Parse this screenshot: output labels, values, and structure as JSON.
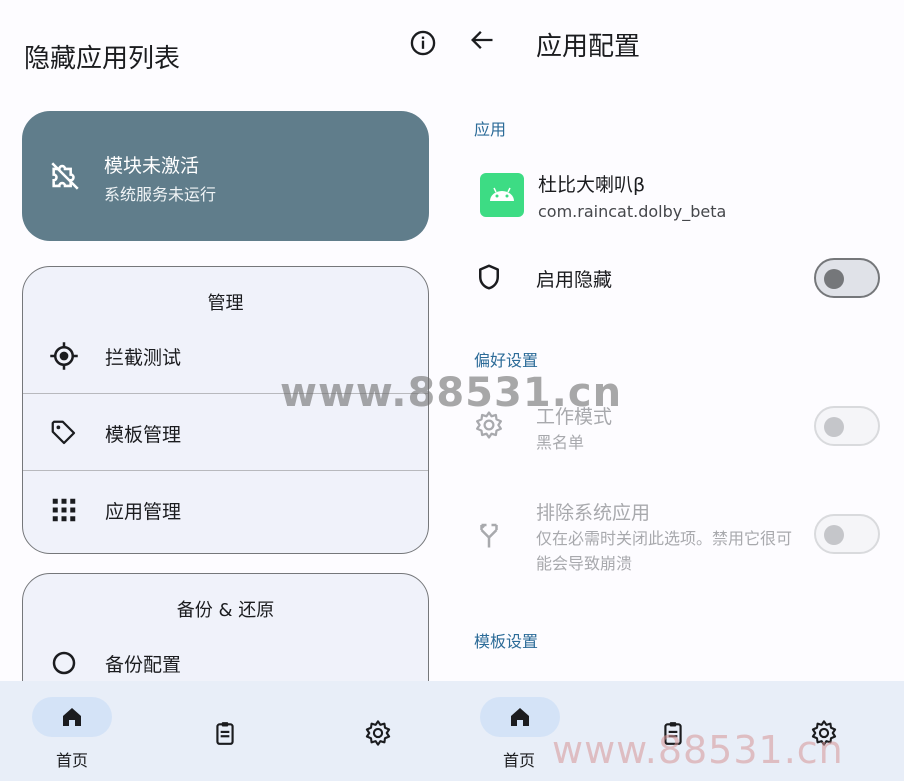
{
  "left": {
    "title": "隐藏应用列表",
    "info_icon": "info-icon",
    "status": {
      "icon": "extension-off-icon",
      "title": "模块未激活",
      "subtitle": "系统服务未运行",
      "color": "#607d8b"
    },
    "manage": {
      "title": "管理",
      "items": [
        {
          "icon": "gps-target-icon",
          "label": "拦截测试"
        },
        {
          "icon": "tag-icon",
          "label": "模板管理"
        },
        {
          "icon": "apps-grid-icon",
          "label": "应用管理"
        }
      ]
    },
    "backup": {
      "title": "备份 & 还原",
      "items": [
        {
          "icon": "backup-icon",
          "label": "备份配置"
        }
      ]
    },
    "nav": [
      {
        "icon": "home-icon",
        "label": "首页",
        "active": true
      },
      {
        "icon": "clipboard-icon",
        "label": ""
      },
      {
        "icon": "gear-icon",
        "label": ""
      }
    ]
  },
  "right": {
    "title": "应用配置",
    "back_icon": "arrow-back-icon",
    "app_section": "应用",
    "app": {
      "icon": "android-icon",
      "name": "杜比大喇叭β",
      "package": "com.raincat.dolby_beta"
    },
    "enable_hide": {
      "icon": "shield-icon",
      "label": "启用隐藏",
      "on": false
    },
    "pref_section": "偏好设置",
    "work_mode": {
      "icon": "gear-icon",
      "title": "工作模式",
      "subtitle": "黑名单",
      "on": false
    },
    "exclude_sys": {
      "icon": "call-split-icon",
      "title": "排除系统应用",
      "subtitle": "仅在必需时关闭此选项。禁用它很可能会导致崩溃",
      "on": false
    },
    "template_section": "模板设置",
    "nav": [
      {
        "icon": "home-icon",
        "label": "首页",
        "active": true
      },
      {
        "icon": "clipboard-icon",
        "label": ""
      },
      {
        "icon": "gear-icon",
        "label": ""
      }
    ]
  },
  "watermark": {
    "center": "www.88531.cn",
    "corner": "www.88531.cn"
  },
  "colors": {
    "accent": "#2c6b98",
    "status_card": "#607d8b",
    "nav_bg": "#e8eef8",
    "android_green": "#3ddc84"
  }
}
